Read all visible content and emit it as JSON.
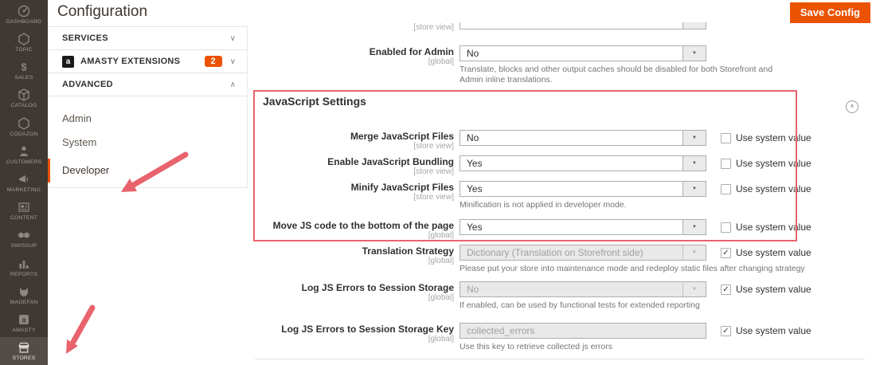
{
  "header": {
    "title": "Configuration",
    "save_button": "Save Config"
  },
  "sidebar": {
    "items": [
      {
        "label": "DASHBOARD",
        "icon": "dashboard-icon",
        "active": false
      },
      {
        "label": "TOPIC",
        "icon": "hexagon-icon",
        "active": false
      },
      {
        "label": "SALES",
        "icon": "dollar-icon",
        "active": false
      },
      {
        "label": "CATALOG",
        "icon": "cube-icon",
        "active": false
      },
      {
        "label": "CODAZON",
        "icon": "hexagon-icon",
        "active": false
      },
      {
        "label": "CUSTOMERS",
        "icon": "person-icon",
        "active": false
      },
      {
        "label": "MARKETING",
        "icon": "megaphone-icon",
        "active": false
      },
      {
        "label": "CONTENT",
        "icon": "content-icon",
        "active": false
      },
      {
        "label": "SWISSUP",
        "icon": "double-hexagon-icon",
        "active": false
      },
      {
        "label": "REPORTS",
        "icon": "bar-chart-icon",
        "active": false
      },
      {
        "label": "MAGEFAN",
        "icon": "fox-icon",
        "active": false
      },
      {
        "label": "AMASTY",
        "icon": "amasty-icon",
        "active": false
      },
      {
        "label": "STORES",
        "icon": "store-icon",
        "active": true
      }
    ]
  },
  "nav": {
    "sections": [
      {
        "label": "SERVICES",
        "chevron": "∨",
        "badge": "",
        "has_logo": false
      },
      {
        "label": "AMASTY EXTENSIONS",
        "chevron": "∨",
        "badge": "2",
        "has_logo": true
      },
      {
        "label": "ADVANCED",
        "chevron": "∧",
        "badge": "",
        "has_logo": false
      }
    ],
    "amasty_logo_letter": "a",
    "advanced_items": [
      {
        "label": "Admin",
        "active": false
      },
      {
        "label": "System",
        "active": false
      },
      {
        "label": "Developer",
        "active": true
      }
    ]
  },
  "form": {
    "section_title": "JavaScript Settings",
    "partial_row": {
      "scope": "[store view]",
      "value": ""
    },
    "rows": [
      {
        "label": "Enabled for Admin",
        "scope": "[global]",
        "control": "select",
        "value": "No",
        "disabled": false,
        "note": "Translate, blocks and other output caches should be disabled for both Storefront and Admin inline translations.",
        "checkbox": null
      },
      {
        "label": "Merge JavaScript Files",
        "scope": "[store view]",
        "control": "select",
        "value": "No",
        "disabled": false,
        "note": "",
        "checkbox": {
          "checked": false,
          "label": "Use system value"
        }
      },
      {
        "label": "Enable JavaScript Bundling",
        "scope": "[store view]",
        "control": "select",
        "value": "Yes",
        "disabled": false,
        "note": "",
        "checkbox": {
          "checked": false,
          "label": "Use system value"
        }
      },
      {
        "label": "Minify JavaScript Files",
        "scope": "[store view]",
        "control": "select",
        "value": "Yes",
        "disabled": false,
        "note": "Minification is not applied in developer mode.",
        "checkbox": {
          "checked": false,
          "label": "Use system value"
        }
      },
      {
        "label": "Move JS code to the bottom of the page",
        "scope": "[global]",
        "control": "select",
        "value": "Yes",
        "disabled": false,
        "note": "",
        "checkbox": {
          "checked": false,
          "label": "Use system value"
        }
      },
      {
        "label": "Translation Strategy",
        "scope": "[global]",
        "control": "select",
        "value": "Dictionary (Translation on Storefront side)",
        "disabled": true,
        "note": "Please put your store into maintenance mode and redeploy static files after changing strategy",
        "checkbox": {
          "checked": true,
          "label": "Use system value"
        }
      },
      {
        "label": "Log JS Errors to Session Storage",
        "scope": "[global]",
        "control": "select",
        "value": "No",
        "disabled": true,
        "note": "If enabled, can be used by functional tests for extended reporting",
        "checkbox": {
          "checked": true,
          "label": "Use system value"
        }
      },
      {
        "label": "Log JS Errors to Session Storage Key",
        "scope": "[global]",
        "control": "input",
        "value": "collected_errors",
        "disabled": true,
        "note": "Use this key to retrieve collected js errors",
        "checkbox": {
          "checked": true,
          "label": "Use system value"
        }
      }
    ]
  },
  "colors": {
    "accent_orange": "#eb5202",
    "sidebar_bg": "#3e3933",
    "annotation_red": "#e8636c",
    "border_gray": "#e3e3e3"
  }
}
